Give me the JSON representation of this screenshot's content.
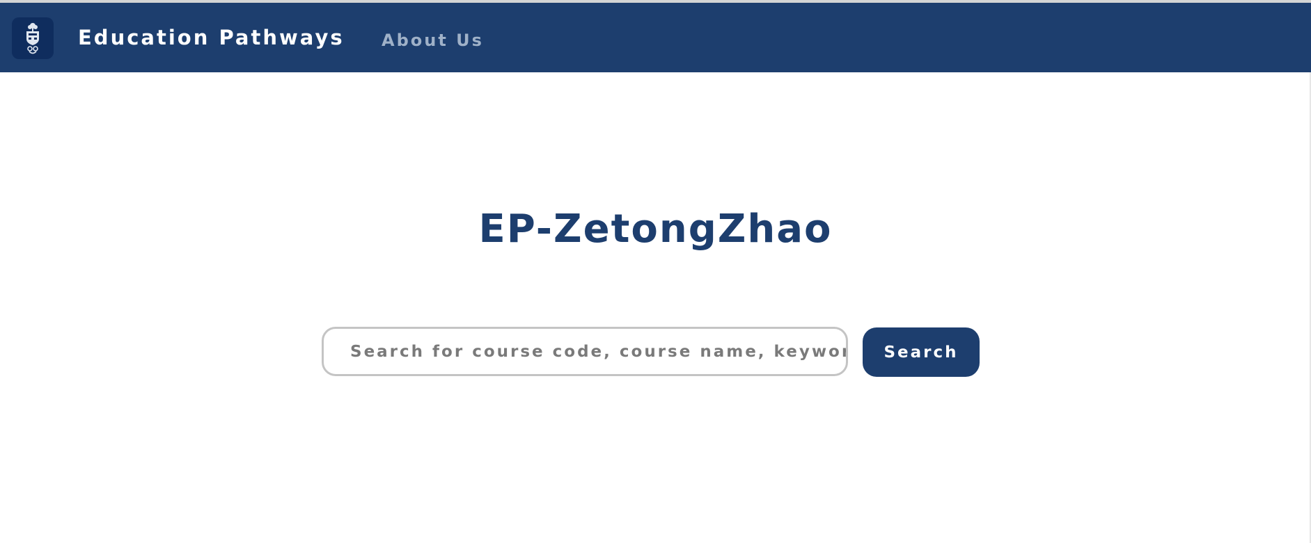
{
  "navbar": {
    "brand": "Education Pathways",
    "links": [
      {
        "label": "About Us"
      }
    ],
    "background_color": "#1d3e6e",
    "logo_icon": "university-crest-icon"
  },
  "main": {
    "title": "EP-ZetongZhao",
    "search": {
      "placeholder": "Search for course code, course name, keywords ...",
      "value": "",
      "button_label": "Search"
    }
  },
  "colors": {
    "primary": "#1d3e6e",
    "muted_link": "#9fb1c8",
    "input_border": "#c4c4c4"
  }
}
